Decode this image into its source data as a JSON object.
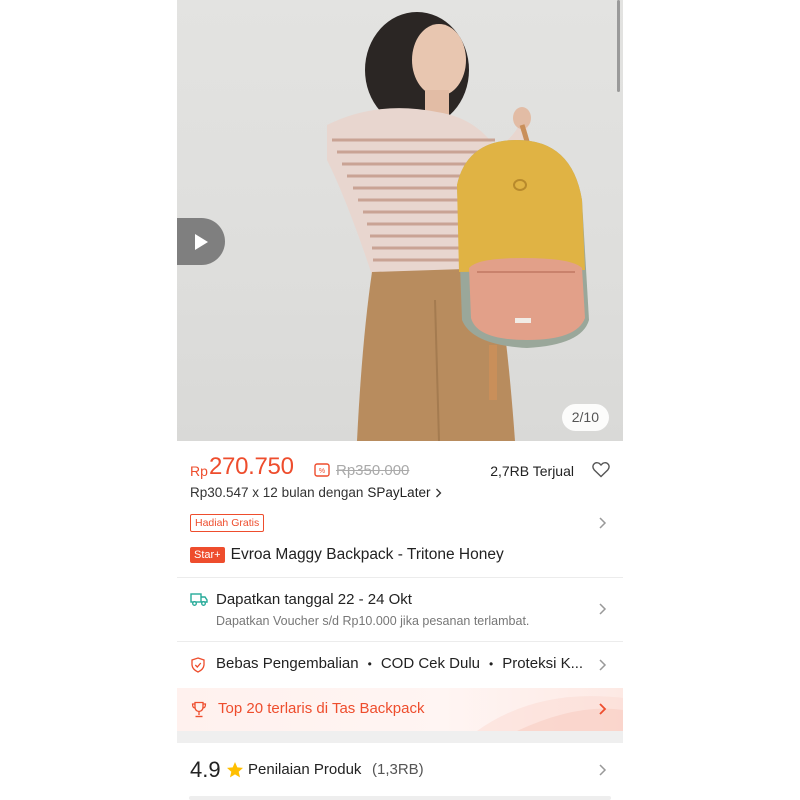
{
  "gallery": {
    "counter": "2/10",
    "play_icon": "play-icon"
  },
  "price": {
    "currency": "Rp",
    "current": "270.750",
    "original": "Rp350.000",
    "sold": "2,7RB Terjual",
    "accent_color": "#ee4d2d"
  },
  "installment": {
    "text": "Rp30.547 x 12 bulan dengan",
    "provider": "SPayLater"
  },
  "promo": {
    "gift_badge": "Hadiah Gratis"
  },
  "product": {
    "badge": "Star+",
    "title": "Evroa Maggy Backpack - Tritone Honey"
  },
  "delivery": {
    "title": "Dapatkan tanggal 22 - 24 Okt",
    "subtitle": "Dapatkan Voucher s/d Rp10.000 jika pesanan terlambat."
  },
  "guarantee": {
    "items": [
      "Bebas Pengembalian",
      "COD Cek Dulu",
      "Proteksi K..."
    ]
  },
  "ranking": {
    "text": "Top 20 terlaris di Tas Backpack"
  },
  "rating": {
    "score": "4.9",
    "label": "Penilaian Produk",
    "count": "(1,3RB)"
  }
}
